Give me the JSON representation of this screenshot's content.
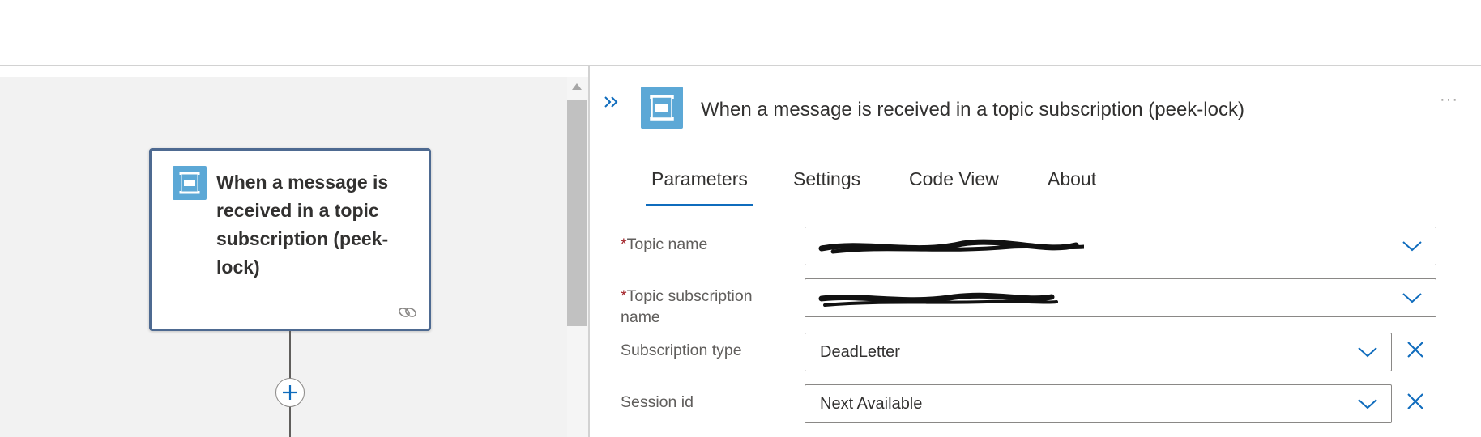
{
  "canvas": {
    "card": {
      "title": "When a message is received in a topic subscription (peek-lock)",
      "icon": "service-bus-icon",
      "footer_icon": "link-icon"
    },
    "add_step_icon": "plus-icon"
  },
  "panel": {
    "collapse_icon": "double-chevron-right-icon",
    "icon": "service-bus-icon",
    "title": "When a message is received in a topic subscription (peek-lock)",
    "more_label": "···",
    "tabs": [
      {
        "label": "Parameters",
        "active": true
      },
      {
        "label": "Settings",
        "active": false
      },
      {
        "label": "Code View",
        "active": false
      },
      {
        "label": "About",
        "active": false
      }
    ],
    "fields": [
      {
        "required_mark": "*",
        "label": "Topic name",
        "value": "",
        "redacted": true
      },
      {
        "required_mark": "*",
        "label": "Topic subscription",
        "label_line2": "name",
        "value": "",
        "redacted": true
      },
      {
        "label": "Subscription type",
        "value": "DeadLetter",
        "clearable": true
      },
      {
        "label": "Session id",
        "value": "Next Available",
        "clearable": true
      }
    ]
  },
  "colors": {
    "accent": "#0f6cbd",
    "card_border": "#4e6a91",
    "icon_bg": "#5ca8d6",
    "required": "#a4262c"
  }
}
